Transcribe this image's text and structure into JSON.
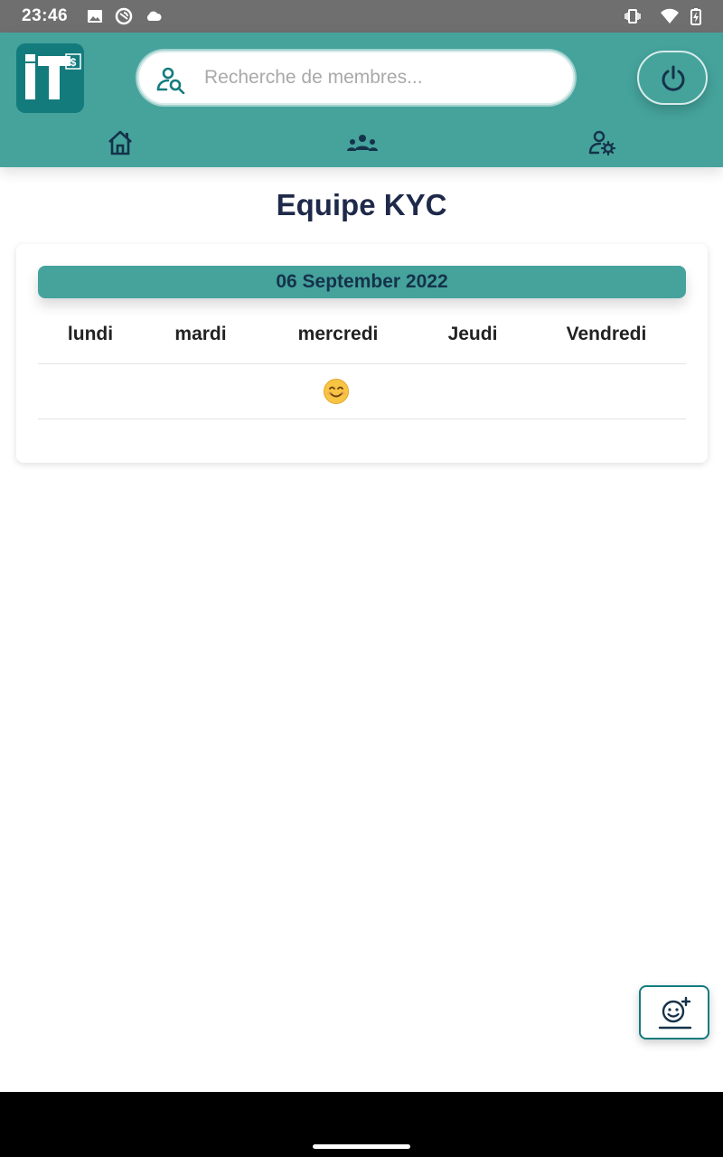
{
  "status_bar": {
    "time": "23:46",
    "icons": [
      "image-icon",
      "sync-icon",
      "cloud-icon",
      "vibrate-icon",
      "wifi-icon",
      "battery-charging-icon"
    ]
  },
  "header": {
    "logo_text": "IT$",
    "search": {
      "placeholder": "Recherche de membres...",
      "value": ""
    },
    "nav": [
      "home-icon",
      "team-icon",
      "user-settings-icon"
    ],
    "accent_color": "#45a39c",
    "dark_color": "#147b7d"
  },
  "page": {
    "title": "Equipe KYC"
  },
  "calendar": {
    "date": "06 September 2022",
    "days": [
      "lundi",
      "mardi",
      "mercredi",
      "Jeudi",
      "Vendredi"
    ],
    "moods": [
      "",
      "",
      "smiling-face",
      "",
      ""
    ]
  },
  "fab": {
    "icon": "add-mood-icon"
  }
}
